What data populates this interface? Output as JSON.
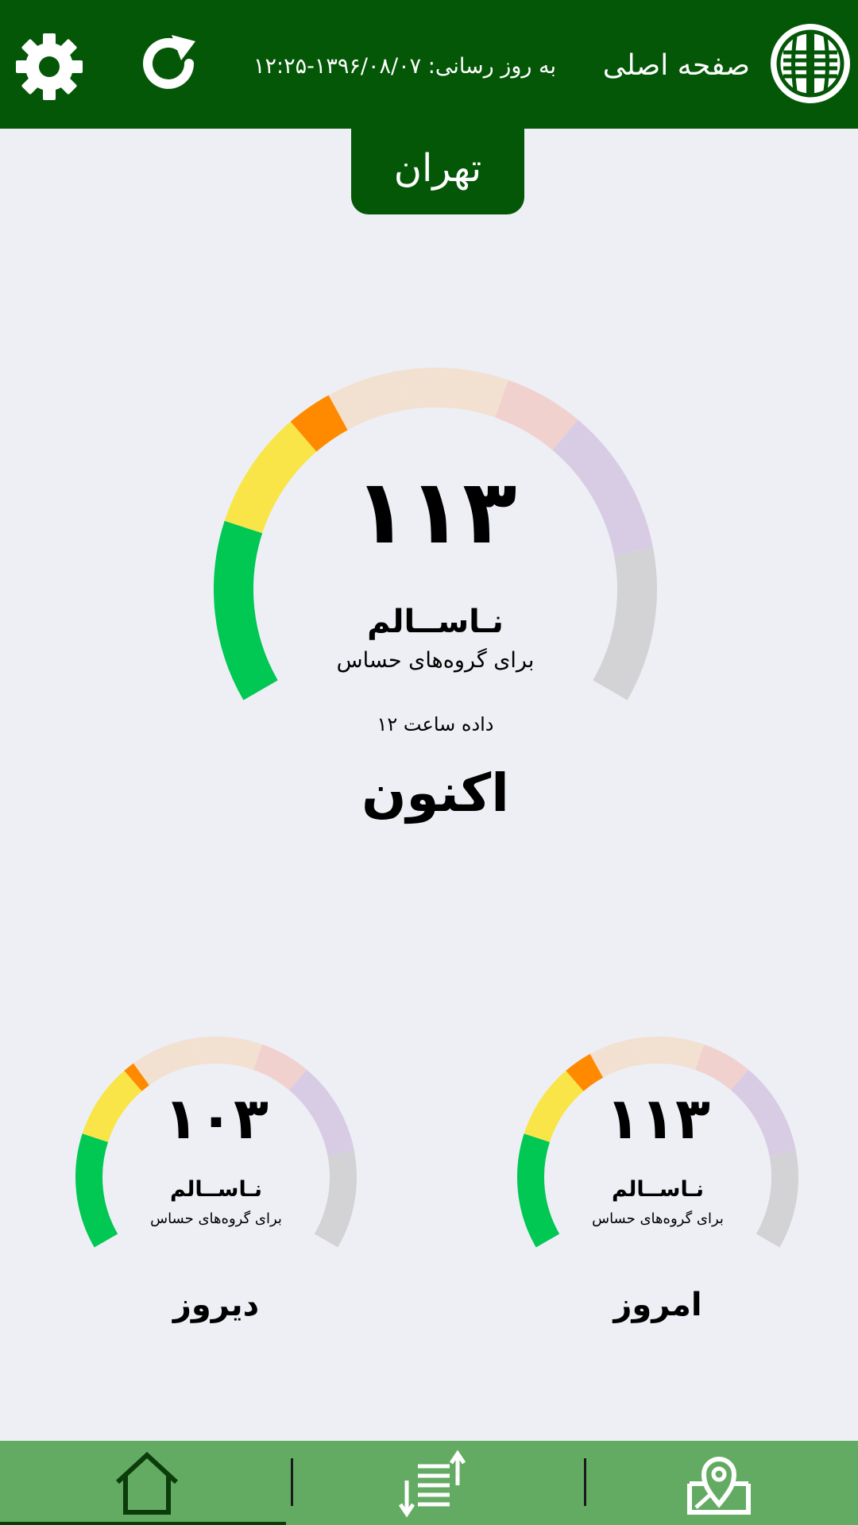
{
  "header": {
    "title": "صفحه اصلی",
    "update_label": "به روز رسانی:",
    "update_value": "۱۳۹۶/۰۸/۰۷-۱۲:۲۵",
    "icons": {
      "logo": "environment-logo-icon",
      "refresh": "refresh-icon",
      "settings": "gear-icon"
    },
    "color": "#055708"
  },
  "city": {
    "name": "تهران"
  },
  "gauges": {
    "current": {
      "value": "۱۱۳",
      "status": "نـاســالم",
      "desc": "برای گروه‌های حساس",
      "note": "داده ساعت ۱۲",
      "label": "اکنون",
      "fraction": 0.38
    },
    "today": {
      "value": "۱۱۳",
      "status": "نـاســالم",
      "desc": "برای گروه‌های حساس",
      "label": "امروز",
      "fraction": 0.38
    },
    "yesterday": {
      "value": "۱۰۳",
      "status": "نـاســالم",
      "desc": "برای گروه‌های حساس",
      "label": "دیروز",
      "fraction": 0.35
    }
  },
  "scale_colors": {
    "good": "#00C853",
    "moderate": "#F9E547",
    "sensitive": "#FF8A00",
    "unhealthy": "#F2E1D1",
    "very_unhealthy": "#F1D1CE",
    "hazardous": "#D8CCE4",
    "rest": "#D3D3D5"
  },
  "bottom_nav": {
    "items": [
      {
        "icon": "map-pin-icon"
      },
      {
        "icon": "sort-list-icon"
      },
      {
        "icon": "home-icon"
      }
    ],
    "color": "#63AB63"
  }
}
